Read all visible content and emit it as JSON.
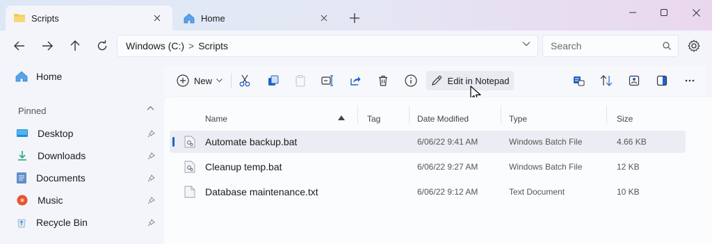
{
  "tabs": [
    {
      "label": "Scripts",
      "icon": "folder-icon",
      "active": true
    },
    {
      "label": "Home",
      "icon": "home-icon",
      "active": false
    }
  ],
  "address": {
    "drive": "Windows (C:)",
    "folder": "Scripts",
    "separator": ">"
  },
  "search": {
    "placeholder": "Search"
  },
  "sidebar": {
    "home": "Home",
    "pinned_label": "Pinned",
    "items": [
      {
        "label": "Desktop",
        "icon": "desktop-icon"
      },
      {
        "label": "Downloads",
        "icon": "download-icon"
      },
      {
        "label": "Documents",
        "icon": "documents-icon"
      },
      {
        "label": "Music",
        "icon": "music-icon"
      },
      {
        "label": "Recycle Bin",
        "icon": "recycle-bin-icon"
      }
    ]
  },
  "toolbar": {
    "new_label": "New",
    "edit_label": "Edit in Notepad"
  },
  "columns": [
    "Name",
    "Tag",
    "Date Modified",
    "Type",
    "Size"
  ],
  "files": [
    {
      "name": "Automate backup.bat",
      "date": "6/06/22  9:41 AM",
      "type": "Windows Batch File",
      "size": "4.66 KB",
      "selected": true
    },
    {
      "name": "Cleanup temp.bat",
      "date": "6/06/22  9:27 AM",
      "type": "Windows Batch File",
      "size": "12 KB",
      "selected": false
    },
    {
      "name": "Database maintenance.txt",
      "date": "6/06/22  9:12 AM",
      "type": "Text Document",
      "size": "10 KB",
      "selected": false
    }
  ],
  "colors": {
    "accent": "#1f63c7",
    "folder": "#f2c94c"
  }
}
